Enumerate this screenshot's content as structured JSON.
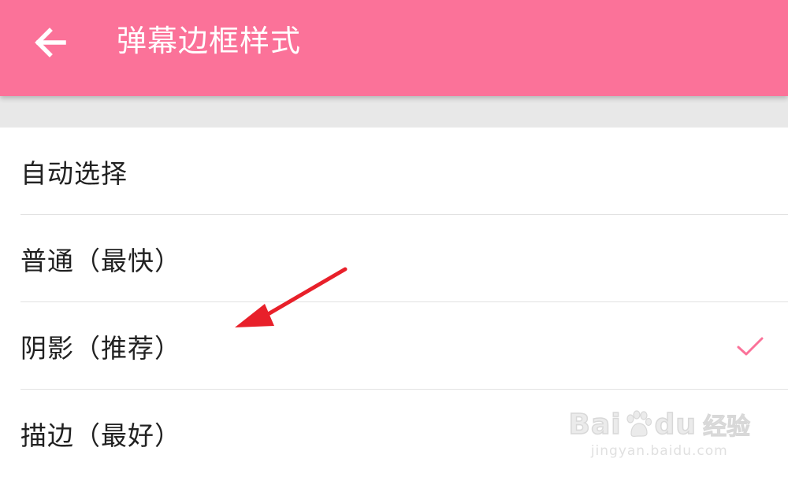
{
  "header": {
    "title": "弹幕边框样式",
    "back_icon": "arrow-left-icon",
    "background_color": "#fb7299"
  },
  "options": [
    {
      "label": "自动选择",
      "selected": false
    },
    {
      "label": "普通（最快）",
      "selected": false
    },
    {
      "label": "阴影（推荐）",
      "selected": true
    },
    {
      "label": "描边（最好）",
      "selected": false
    }
  ],
  "selected_icon": "check-icon",
  "accent_color": "#fb7299",
  "annotation": {
    "icon": "red-arrow-pointer-icon",
    "color": "#e8202a"
  },
  "watermark": {
    "brand_left": "Bai",
    "brand_right": "du",
    "brand_cn": "经验",
    "url": "jingyan.baidu.com"
  }
}
